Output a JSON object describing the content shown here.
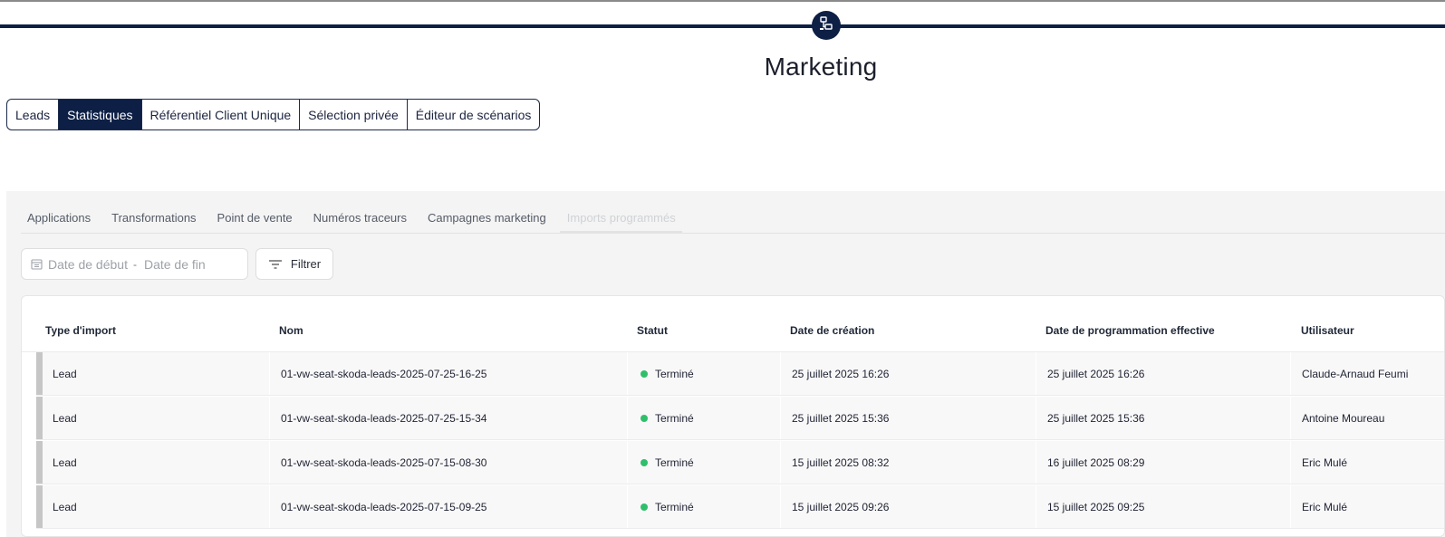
{
  "app": {
    "title": "Marketing",
    "icons": {
      "logo": "network-nodes-icon"
    },
    "colors": {
      "primary": "#0d1f45",
      "success": "#2fbf6c"
    }
  },
  "module_tabs": [
    {
      "label": "Leads",
      "active": false
    },
    {
      "label": "Statistiques",
      "active": true
    },
    {
      "label": "Référentiel Client Unique",
      "active": false
    },
    {
      "label": "Sélection privée",
      "active": false
    },
    {
      "label": "Éditeur de scénarios",
      "active": false
    }
  ],
  "sub_tabs": [
    {
      "label": "Applications",
      "active": false
    },
    {
      "label": "Transformations",
      "active": false
    },
    {
      "label": "Point de vente",
      "active": false
    },
    {
      "label": "Numéros traceurs",
      "active": false
    },
    {
      "label": "Campagnes marketing",
      "active": false
    },
    {
      "label": "Imports programmés",
      "active": true
    }
  ],
  "filters": {
    "start_placeholder": "Date de début",
    "separator": "-",
    "end_placeholder": "Date de fin",
    "filter_label": "Filtrer",
    "icons": {
      "calendar": "calendar-icon",
      "filter": "filter-lines-icon"
    }
  },
  "table": {
    "columns": [
      "Type d'import",
      "Nom",
      "Statut",
      "Date de création",
      "Date de programmation effective",
      "Utilisateur"
    ],
    "rows": [
      {
        "type": "Lead",
        "nom": "01-vw-seat-skoda-leads-2025-07-25-16-25",
        "statut": "Terminé",
        "creation": "25 juillet 2025 16:26",
        "programmation": "25 juillet 2025 16:26",
        "utilisateur": "Claude-Arnaud Feumi"
      },
      {
        "type": "Lead",
        "nom": "01-vw-seat-skoda-leads-2025-07-25-15-34",
        "statut": "Terminé",
        "creation": "25 juillet 2025 15:36",
        "programmation": "25 juillet 2025 15:36",
        "utilisateur": "Antoine Moureau"
      },
      {
        "type": "Lead",
        "nom": "01-vw-seat-skoda-leads-2025-07-15-08-30",
        "statut": "Terminé",
        "creation": "15 juillet 2025 08:32",
        "programmation": "16 juillet 2025 08:29",
        "utilisateur": "Eric Mulé"
      },
      {
        "type": "Lead",
        "nom": "01-vw-seat-skoda-leads-2025-07-15-09-25",
        "statut": "Terminé",
        "creation": "15 juillet 2025 09:26",
        "programmation": "15 juillet 2025 09:25",
        "utilisateur": "Eric Mulé"
      }
    ]
  }
}
